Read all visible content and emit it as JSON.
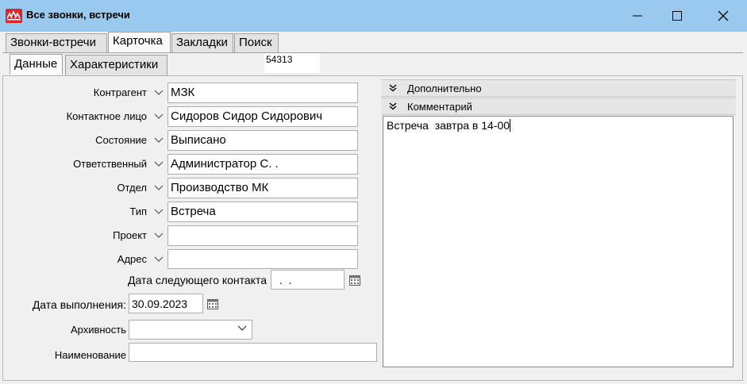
{
  "window": {
    "title": "Все звонки, встречи"
  },
  "tabs": [
    {
      "label": "Звонки-встречи",
      "active": false
    },
    {
      "label": "Карточка",
      "active": true
    },
    {
      "label": "Закладки",
      "active": false
    },
    {
      "label": "Поиск",
      "active": false
    }
  ],
  "subtabs": [
    {
      "label": "Данные",
      "active": true
    },
    {
      "label": "Характеристики",
      "active": false
    }
  ],
  "record_id": "54313",
  "form": {
    "contractor": {
      "label": "Контрагент",
      "value": "МЗК"
    },
    "contact_person": {
      "label": "Контактное лицо",
      "value": "Сидоров Сидор Сидорович"
    },
    "status": {
      "label": "Состояние",
      "value": "Выписано"
    },
    "responsible": {
      "label": "Ответственный",
      "value": "Администратор С. ."
    },
    "department": {
      "label": "Отдел",
      "value": "Производство МК"
    },
    "type": {
      "label": "Тип",
      "value": "Встреча"
    },
    "project": {
      "label": "Проект",
      "value": ""
    },
    "address": {
      "label": "Адрес",
      "value": ""
    },
    "next_contact_date": {
      "label": "Дата следующего контакта",
      "value": " .  ."
    },
    "completion_date": {
      "label": "Дата выполнения:",
      "value": "30.09.2023"
    },
    "archive": {
      "label": "Архивность",
      "value": ""
    },
    "name": {
      "label": "Наименование",
      "value": ""
    }
  },
  "right_panel": {
    "additional": {
      "label": "Дополнительно"
    },
    "comment": {
      "label": "Комментарий",
      "text": "Встреча  завтра в 14-00"
    }
  },
  "colors": {
    "titlebar": "#99c9ef",
    "logo": "#d9262b",
    "background": "#f0f0f0"
  }
}
